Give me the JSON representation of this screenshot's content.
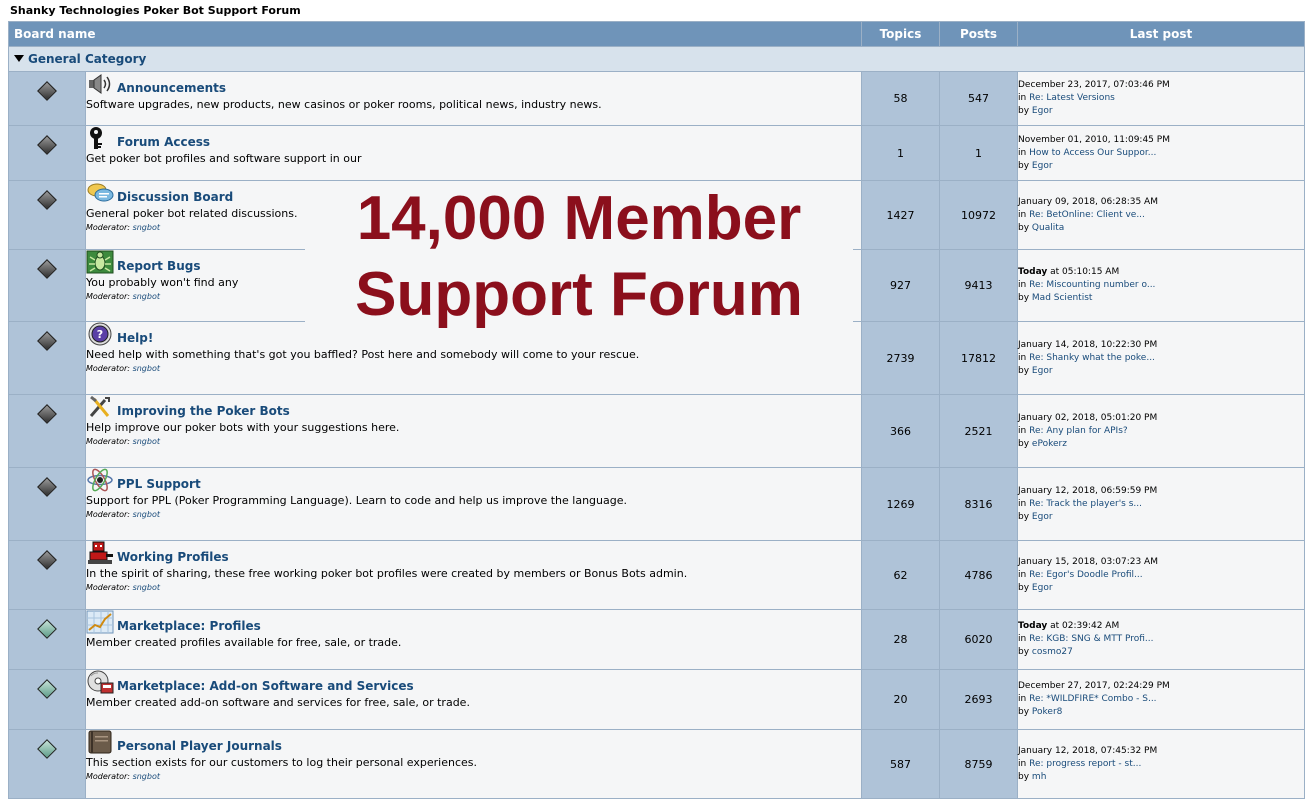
{
  "site_title": "Shanky Technologies Poker Bot Support Forum",
  "header": {
    "board_name": "Board name",
    "topics": "Topics",
    "posts": "Posts",
    "last_post": "Last post"
  },
  "category": {
    "name": "General Category",
    "icon": "triangle-down-icon"
  },
  "overlay": {
    "line1": "14,000 Member",
    "line2": "Support Forum",
    "color": "#8b0f1c"
  },
  "colors": {
    "header_bg": "#6f94b9",
    "link": "#194b7a",
    "indicator_on": "#303030",
    "indicator_off": "#5e9c88"
  },
  "boards": [
    {
      "name": "Announcements",
      "icon": "speaker-icon",
      "desc": "Software upgrades, new products, new casinos or poker rooms, political news, industry news.",
      "moderator_label": "",
      "moderator": "",
      "topics": "58",
      "posts": "547",
      "lp_date": "December 23, 2017, 07:03:46 PM",
      "lp_date_bold": "",
      "lp_in": "in",
      "lp_subject": "Re: Latest Versions",
      "lp_by": "by",
      "lp_user": "Egor",
      "new": true
    },
    {
      "name": "Forum Access",
      "icon": "key-icon",
      "desc": "Get poker bot profiles and software support in our",
      "moderator_label": "",
      "moderator": "",
      "topics": "1",
      "posts": "1",
      "lp_date": "November 01, 2010, 11:09:45 PM",
      "lp_date_bold": "",
      "lp_in": "in",
      "lp_subject": "How to Access Our Suppor...",
      "lp_by": "by",
      "lp_user": "Egor",
      "new": true
    },
    {
      "name": "Discussion Board",
      "icon": "chat-bubbles-icon",
      "desc": "General poker bot related discussions.",
      "moderator_label": "Moderator:",
      "moderator": "sngbot",
      "topics": "1427",
      "posts": "10972",
      "lp_date": "January 09, 2018, 06:28:35 AM",
      "lp_date_bold": "",
      "lp_in": "in",
      "lp_subject": "Re: BetOnline: Client ve...",
      "lp_by": "by",
      "lp_user": "Qualita",
      "new": true
    },
    {
      "name": "Report Bugs",
      "icon": "bug-icon",
      "desc": "You probably won't find any",
      "moderator_label": "Moderator:",
      "moderator": "sngbot",
      "topics": "927",
      "posts": "9413",
      "lp_date": " at 05:10:15 AM",
      "lp_date_bold": "Today",
      "lp_in": "in",
      "lp_subject": "Re: Miscounting number o...",
      "lp_by": "by",
      "lp_user": "Mad Scientist",
      "new": true
    },
    {
      "name": "Help!",
      "icon": "help-icon",
      "desc": "Need help with something that's got you baffled? Post here and somebody will come to your rescue.",
      "moderator_label": "Moderator:",
      "moderator": "sngbot",
      "topics": "2739",
      "posts": "17812",
      "lp_date": "January 14, 2018, 10:22:30 PM",
      "lp_date_bold": "",
      "lp_in": "in",
      "lp_subject": "Re: Shanky what the poke...",
      "lp_by": "by",
      "lp_user": "Egor",
      "new": true
    },
    {
      "name": "Improving the Poker Bots",
      "icon": "tools-icon",
      "desc": "Help improve our poker bots with your suggestions here.",
      "moderator_label": "Moderator:",
      "moderator": "sngbot",
      "topics": "366",
      "posts": "2521",
      "lp_date": "January 02, 2018, 05:01:20 PM",
      "lp_date_bold": "",
      "lp_in": "in",
      "lp_subject": "Re: Any plan for APIs?",
      "lp_by": "by",
      "lp_user": "ePokerz",
      "new": true
    },
    {
      "name": "PPL Support",
      "icon": "atom-icon",
      "desc": "Support for PPL (Poker Programming Language). Learn to code and help us improve the language.",
      "moderator_label": "Moderator:",
      "moderator": "sngbot",
      "topics": "1269",
      "posts": "8316",
      "lp_date": "January 12, 2018, 06:59:59 PM",
      "lp_date_bold": "",
      "lp_in": "in",
      "lp_subject": "Re: Track the player's s...",
      "lp_by": "by",
      "lp_user": "Egor",
      "new": true
    },
    {
      "name": "Working Profiles",
      "icon": "robot-icon",
      "desc": "In the spirit of sharing, these free working poker bot profiles were created by members or Bonus Bots admin.",
      "moderator_label": "Moderator:",
      "moderator": "sngbot",
      "topics": "62",
      "posts": "4786",
      "lp_date": "January 15, 2018, 03:07:23 AM",
      "lp_date_bold": "",
      "lp_in": "in",
      "lp_subject": "Re: Egor's Doodle Profil...",
      "lp_by": "by",
      "lp_user": "Egor",
      "new": true
    },
    {
      "name": "Marketplace: Profiles",
      "icon": "chart-icon",
      "desc": "Member created profiles available for free, sale, or trade.",
      "moderator_label": "",
      "moderator": "",
      "topics": "28",
      "posts": "6020",
      "lp_date": " at 02:39:42 AM",
      "lp_date_bold": "Today",
      "lp_in": "in",
      "lp_subject": "Re: KGB: SNG & MTT Profi...",
      "lp_by": "by",
      "lp_user": "cosmo27",
      "new": false
    },
    {
      "name": "Marketplace: Add-on Software and Services",
      "icon": "software-cd-icon",
      "desc": "Member created add-on software and services for free, sale, or trade.",
      "moderator_label": "",
      "moderator": "",
      "topics": "20",
      "posts": "2693",
      "lp_date": "December 27, 2017, 02:24:29 PM",
      "lp_date_bold": "",
      "lp_in": "in",
      "lp_subject": "Re: *WILDFIRE* Combo - S...",
      "lp_by": "by",
      "lp_user": "Poker8",
      "new": false
    },
    {
      "name": "Personal Player Journals",
      "icon": "journal-icon",
      "desc": "This section exists for our customers to log their personal experiences.",
      "moderator_label": "Moderator:",
      "moderator": "sngbot",
      "topics": "587",
      "posts": "8759",
      "lp_date": "January 12, 2018, 07:45:32 PM",
      "lp_date_bold": "",
      "lp_in": "in",
      "lp_subject": "Re: progress report - st...",
      "lp_by": "by",
      "lp_user": "mh",
      "new": false
    }
  ]
}
